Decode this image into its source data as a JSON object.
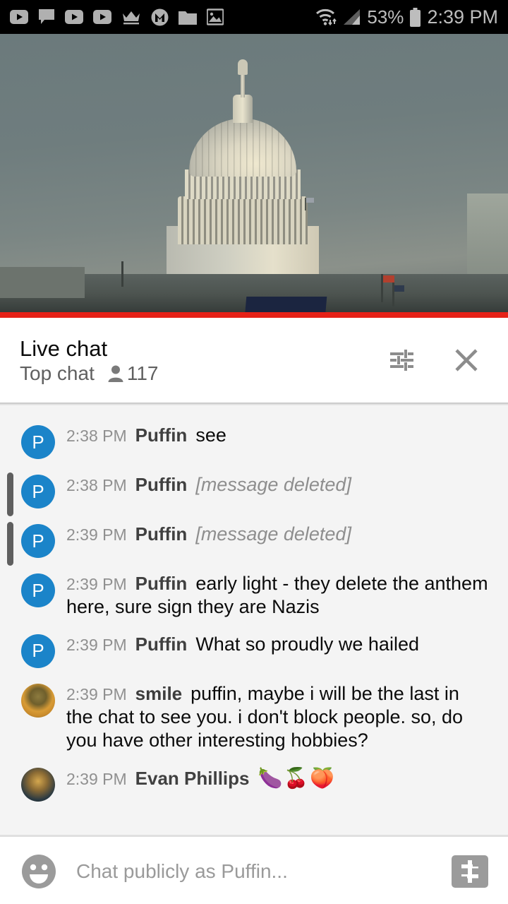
{
  "status_bar": {
    "icons": [
      "youtube-icon",
      "chat-bubble-icon",
      "youtube-icon",
      "youtube-icon",
      "crown-icon",
      "m-badge-icon",
      "folder-icon",
      "photo-icon"
    ],
    "wifi_icon": "wifi-icon",
    "signal_icon": "cell-signal-icon",
    "battery_percent": "53%",
    "battery_icon": "battery-icon",
    "time": "2:39 PM"
  },
  "video": {
    "name": "us-capitol-livestream",
    "progress_color": "#e62117"
  },
  "chat_header": {
    "title": "Live chat",
    "mode": "Top chat",
    "viewer_icon": "person-icon",
    "viewer_count": "117",
    "settings_icon": "chat-settings-sliders-icon",
    "close_icon": "close-icon"
  },
  "messages": [
    {
      "avatar_type": "letter",
      "avatar_letter": "P",
      "avatar_color": "#1b84c9",
      "time": "2:38 PM",
      "author": "Puffin",
      "text": "see",
      "deleted": false,
      "emoji": ""
    },
    {
      "avatar_type": "letter",
      "avatar_letter": "P",
      "avatar_color": "#1b84c9",
      "time": "2:38 PM",
      "author": "Puffin",
      "text": "[message deleted]",
      "deleted": true,
      "emoji": ""
    },
    {
      "avatar_type": "letter",
      "avatar_letter": "P",
      "avatar_color": "#1b84c9",
      "time": "2:39 PM",
      "author": "Puffin",
      "text": "[message deleted]",
      "deleted": true,
      "emoji": ""
    },
    {
      "avatar_type": "letter",
      "avatar_letter": "P",
      "avatar_color": "#1b84c9",
      "time": "2:39 PM",
      "author": "Puffin",
      "text": "early light - they delete the anthem here, sure sign they are Nazis",
      "deleted": false,
      "emoji": ""
    },
    {
      "avatar_type": "letter",
      "avatar_letter": "P",
      "avatar_color": "#1b84c9",
      "time": "2:39 PM",
      "author": "Puffin",
      "text": "What so proudly we hailed",
      "deleted": false,
      "emoji": ""
    },
    {
      "avatar_type": "photo",
      "avatar_letter": "",
      "avatar_color": "",
      "time": "2:39 PM",
      "author": "smile",
      "text": "puffin, maybe i will be the last in the chat to see you. i don't block people. so, do you have other interesting hobbies?",
      "deleted": false,
      "emoji": ""
    },
    {
      "avatar_type": "photo",
      "avatar_letter": "",
      "avatar_color": "",
      "time": "2:39 PM",
      "author": "Evan Phillips",
      "text": "",
      "deleted": false,
      "emoji": "🍆🍒🍑"
    }
  ],
  "input_bar": {
    "emoji_icon": "emoji-smiley-icon",
    "placeholder": "Chat publicly as Puffin...",
    "superchat_icon": "super-chat-dollar-icon"
  }
}
